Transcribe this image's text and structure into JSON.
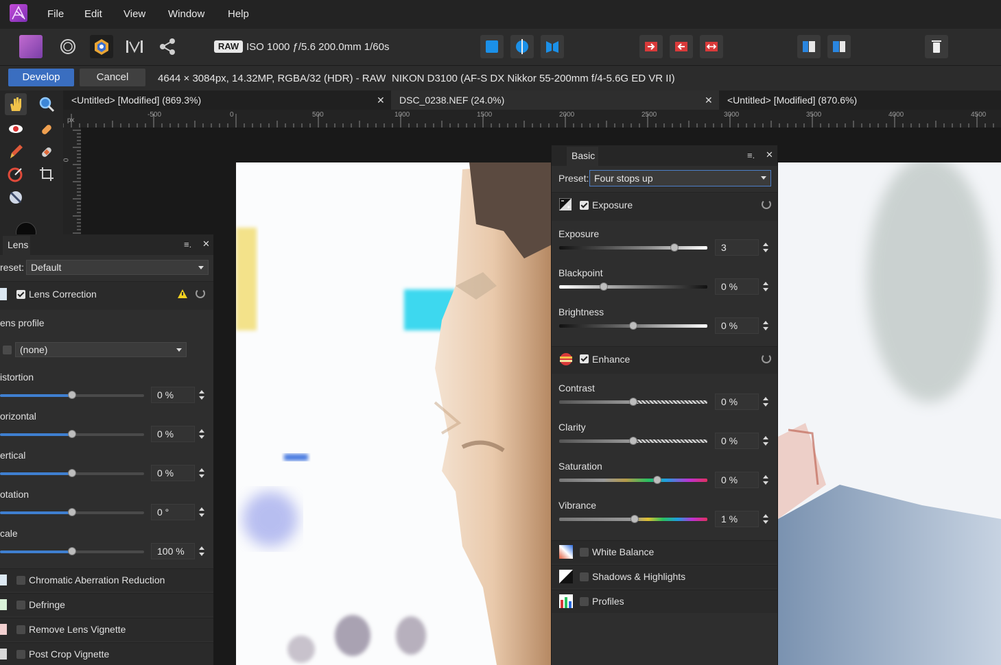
{
  "menu": {
    "items": [
      "File",
      "Edit",
      "View",
      "Window",
      "Help"
    ]
  },
  "toolbar": {
    "raw_badge": "RAW",
    "exif": "ISO 1000 ƒ/5.6 200.0mm 1/60s"
  },
  "contextbar": {
    "develop_label": "Develop",
    "cancel_label": "Cancel",
    "info": "4644 × 3084px, 14.32MP, RGBA/32 (HDR) - RAW",
    "camera": "NIKON D3100 (AF-S DX Nikkor 55-200mm f/4-5.6G ED VR II)"
  },
  "tabs": [
    {
      "label": "<Untitled> [Modified] (869.3%)",
      "active": false
    },
    {
      "label": "DSC_0238.NEF (24.0%)",
      "active": true
    },
    {
      "label": "<Untitled> [Modified] (870.6%)",
      "active": false
    }
  ],
  "ruler": {
    "unit": "px",
    "h_labels": [
      "-500",
      "0",
      "500",
      "1000",
      "1500",
      "2000",
      "2500",
      "3000",
      "3500",
      "4000",
      "4500"
    ],
    "v_label": "0"
  },
  "lens_panel": {
    "title": "Lens",
    "preset_label": "reset:",
    "preset_value": "Default",
    "lens_correction_label": "Lens Correction",
    "lens_profile_label": "ens profile",
    "lens_profile_value": "(none)",
    "sliders": [
      {
        "label": "istortion",
        "value": "0 %",
        "level": 0.5
      },
      {
        "label": "orizontal",
        "value": "0 %",
        "level": 0.5
      },
      {
        "label": "ertical",
        "value": "0 %",
        "level": 0.5
      },
      {
        "label": "otation",
        "value": "0 °",
        "level": 0.5
      },
      {
        "label": "cale",
        "value": "100 %",
        "level": 0.5
      }
    ],
    "sections": [
      {
        "label": "Chromatic Aberration Reduction",
        "checked": false
      },
      {
        "label": "Defringe",
        "checked": false
      },
      {
        "label": "Remove Lens Vignette",
        "checked": false
      },
      {
        "label": "Post Crop Vignette",
        "checked": false
      }
    ]
  },
  "basic_panel": {
    "title": "Basic",
    "preset_label": "Preset:",
    "preset_value": "Four stops up",
    "exposure_section": "Exposure",
    "enhance_section": "Enhance",
    "exposure_sliders": [
      {
        "label": "Exposure",
        "value": "3",
        "level": 0.78
      },
      {
        "label": "Blackpoint",
        "value": "0 %",
        "level": 0.3
      },
      {
        "label": "Brightness",
        "value": "0 %",
        "level": 0.5
      }
    ],
    "enhance_sliders": [
      {
        "label": "Contrast",
        "value": "0 %",
        "level": 0.5
      },
      {
        "label": "Clarity",
        "value": "0 %",
        "level": 0.5
      },
      {
        "label": "Saturation",
        "value": "0 %",
        "level": 0.66
      },
      {
        "label": "Vibrance",
        "value": "1 %",
        "level": 0.51
      }
    ],
    "sections": [
      {
        "label": "White Balance",
        "checked": false
      },
      {
        "label": "Shadows & Highlights",
        "checked": false
      },
      {
        "label": "Profiles",
        "checked": false
      }
    ]
  },
  "colors": {
    "accent": "#3a6ec0",
    "panel": "#2e2e2e"
  }
}
